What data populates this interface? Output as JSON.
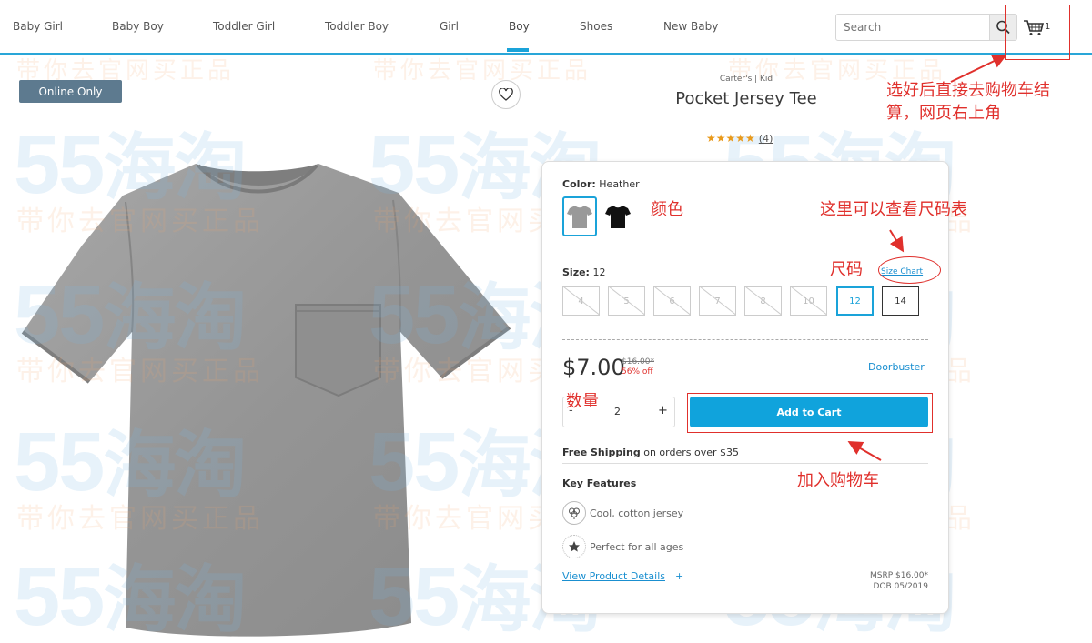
{
  "nav": {
    "items": [
      "Baby Girl",
      "Baby Boy",
      "Toddler Girl",
      "Toddler Boy",
      "Girl",
      "Boy",
      "Shoes",
      "New Baby"
    ],
    "active": "Boy",
    "search_placeholder": "Search",
    "cart_count": "1"
  },
  "watermark": {
    "numbers": "55",
    "logo": "海淘",
    "slogan": "带你去官网买正品"
  },
  "product": {
    "badge": "Online Only",
    "brand": "Carter's | Kid",
    "title": "Pocket Jersey Tee",
    "stars": "★★★★★",
    "rating": 5,
    "review_count": "(4)",
    "color_label": "Color:",
    "color_value": "Heather",
    "swatches": [
      {
        "name": "Heather",
        "color": "#9a9a9a"
      },
      {
        "name": "Black",
        "color": "#111111"
      }
    ],
    "size_label": "Size:",
    "size_value": "12",
    "size_chart": "Size Chart",
    "sizes": [
      {
        "label": "4",
        "state": "unavailable"
      },
      {
        "label": "5",
        "state": "unavailable"
      },
      {
        "label": "6",
        "state": "unavailable"
      },
      {
        "label": "7",
        "state": "unavailable"
      },
      {
        "label": "8",
        "state": "unavailable"
      },
      {
        "label": "10",
        "state": "unavailable"
      },
      {
        "label": "12",
        "state": "selected"
      },
      {
        "label": "14",
        "state": "available"
      }
    ],
    "price": "$7.00",
    "was_price": "$16.00*",
    "discount": "56% off",
    "promo": "Doorbuster",
    "qty_minus": "-",
    "quantity": "2",
    "qty_plus": "+",
    "add_to_cart": "Add to Cart",
    "shipping_bold": "Free Shipping",
    "shipping_rest": " on orders over $35",
    "key_features_title": "Key Features",
    "features": [
      "Cool, cotton jersey",
      "Perfect for all ages"
    ],
    "view_details": "View Product Details",
    "view_details_plus": "+",
    "msrp": "MSRP $16.00*",
    "dob": "DOB 05/2019"
  },
  "annotations": {
    "cart_note": "选好后直接去购物车结算，网页右上角",
    "color_note": "颜色",
    "size_chart_note": "这里可以查看尺码表",
    "size_note": "尺码",
    "qty_note": "数量",
    "add_cart_note": "加入购物车",
    "color": "#e0302c"
  },
  "colors": {
    "accent": "#10a3dc",
    "nav_underline": "#1aa3d9",
    "badge": "#5d7a8f",
    "star": "#e99a1c",
    "discount": "#e0302c"
  }
}
